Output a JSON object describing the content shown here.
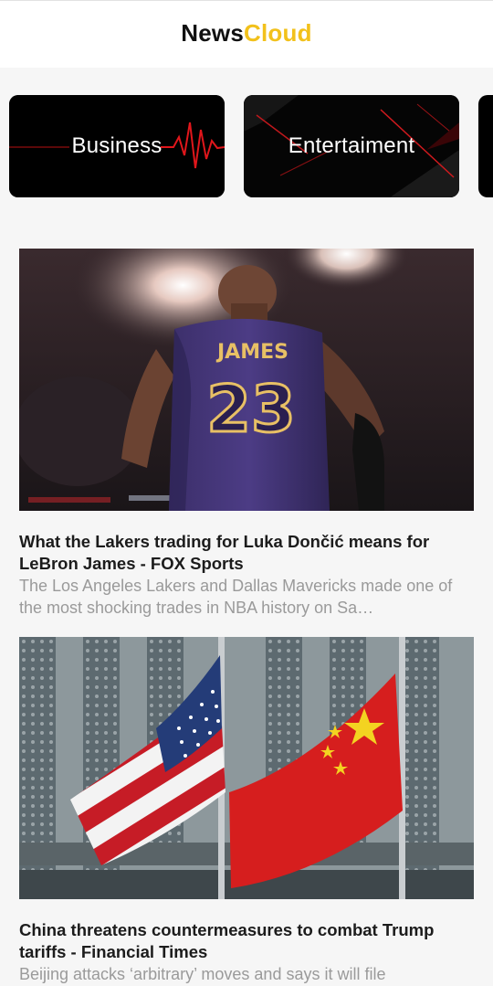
{
  "header": {
    "brand_part1": "News",
    "brand_part2": "Cloud"
  },
  "categories": [
    {
      "label": "Business"
    },
    {
      "label": "Entertaiment"
    }
  ],
  "articles": [
    {
      "title": "What the Lakers trading for Luka Dončić means for LeBron James - FOX Sports",
      "description": "The Los Angeles Lakers and Dallas Mavericks made one of the most shocking trades in NBA history on Sa…",
      "image_jersey_name": "JAMES",
      "image_jersey_number": "23"
    },
    {
      "title": "China threatens countermeasures to combat Trump tariffs - Financial Times",
      "description": "Beijing attacks ‘arbitrary’ moves and says it will file"
    }
  ],
  "colors": {
    "brand_accent": "#f2c11b",
    "pulse_red": "#e0161b"
  }
}
